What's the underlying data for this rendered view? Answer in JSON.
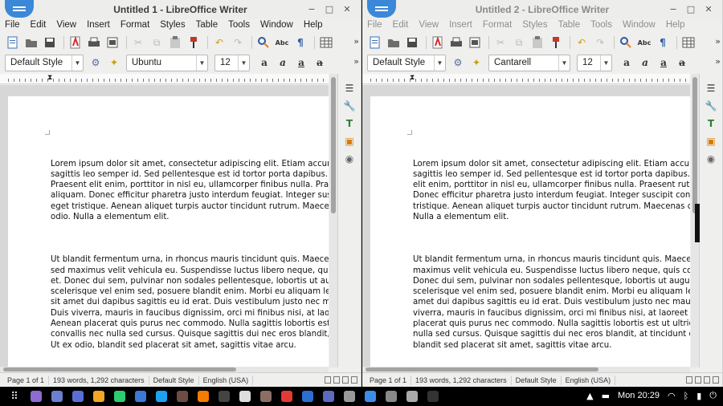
{
  "windows": [
    {
      "title": "Untitled 1 - LibreOffice Writer",
      "menu": [
        "File",
        "Edit",
        "View",
        "Insert",
        "Format",
        "Styles",
        "Table",
        "Tools",
        "Window",
        "Help"
      ],
      "paragraph_style": "Default Style",
      "font_name": "Ubuntu",
      "font_size": "12",
      "paragraphs": [
        "Lorem ipsum dolor sit amet, consectetur adipiscing elit. Etiam accumsan\nsagittis leo semper id. Sed pellentesque est id tortor porta dapibus. In ut\nPraesent elit enim, porttitor in nisl eu, ullamcorper finibus nulla. Praesen\naliquam. Donec efficitur pharetra justo interdum feugiat. Integer suscipit\neget tristique. Aenean aliquet turpis auctor tincidunt rutrum. Maecenas c\nodio. Nulla a elementum elit.",
        "Ut blandit fermentum urna, in rhoncus mauris tincidunt quis. Maecenas s\nsed maximus velit vehicula eu. Suspendisse luctus libero neque, quis cons\net. Donec dui sem, pulvinar non sodales pellentesque, lobortis ut augue.\nscelerisque vel enim sed, posuere blandit enim. Morbi eu aliquam leo. Qu\nsit amet dui dapibus sagittis eu id erat. Duis vestibulum justo nec mauris\nDuis viverra, mauris in faucibus dignissim, orci mi finibus nisi, at laoreet le\nAenean placerat quis purus nec commodo. Nulla sagittis lobortis est ut ul\nconvallis nec nulla sed cursus. Quisque sagittis dui nec eros blandit, at tin\nUt ex odio, blandit sed placerat sit amet, sagittis vitae arcu."
      ],
      "status": {
        "page": "Page 1 of 1",
        "words": "193 words, 1,292 characters",
        "style": "Default Style",
        "language": "English (USA)"
      }
    },
    {
      "title": "Untitled 2 - LibreOffice Writer",
      "menu": [
        "File",
        "Edit",
        "View",
        "Insert",
        "Format",
        "Styles",
        "Table",
        "Tools",
        "Window",
        "Help"
      ],
      "paragraph_style": "Default Style",
      "font_name": "Cantarell",
      "font_size": "12",
      "paragraphs": [
        "Lorem ipsum dolor sit amet, consectetur adipiscing elit. Etiam accumsan nib\nsagittis leo semper id. Sed pellentesque est id tortor porta dapibus. In ut or\nelit enim, porttitor in nisl eu, ullamcorper finibus nulla. Praesent rutrum inte\nDonec efficitur pharetra justo interdum feugiat. Integer suscipit consequat s\ntristique. Aenean aliquet turpis auctor tincidunt rutrum. Maecenas convallis\nNulla a elementum elit.",
        "Ut blandit fermentum urna, in rhoncus mauris tincidunt quis. Maecenas susc\nmaximus velit vehicula eu. Suspendisse luctus libero neque, quis consequat\nDonec dui sem, pulvinar non sodales pellentesque, lobortis ut augue. Nunc\nscelerisque vel enim sed, posuere blandit enim. Morbi eu aliquam leo. Quisq\namet dui dapibus sagittis eu id erat. Duis vestibulum justo nec mauris faucib\nviverra, mauris in faucibus dignissim, orci mi finibus nisi, at laoreet lectus nu\nplacerat quis purus nec commodo. Nulla sagittis lobortis est ut ultricies. Qui\nnulla sed cursus. Quisque sagittis dui nec eros blandit, at tincidunt odio orna\nblandit sed placerat sit amet, sagittis vitae arcu."
      ],
      "status": {
        "page": "Page 1 of 1",
        "words": "193 words, 1,292 characters",
        "style": "Default Style",
        "language": "English (USA)"
      }
    }
  ],
  "window_controls": {
    "minimize": "−",
    "maximize": "□",
    "close": "✕"
  },
  "more_glyph": "»",
  "taskbar": {
    "apps": [
      "#8e6bd1",
      "#6b7fd1",
      "#5a6fd6",
      "#f5a623",
      "#2ecc71",
      "#3a7ad6",
      "#1da1f2",
      "#6d4c41",
      "#f57c00",
      "#444444",
      "#dddddd",
      "#8d6e63",
      "#e53935",
      "#2c6fd1",
      "#5c6bc0",
      "#999999",
      "#3b8ee8",
      "#888888",
      "#aaaaaa",
      "#333333"
    ],
    "clock": "Mon 20:29"
  },
  "colors": {
    "accent": "#3b88d8",
    "window_bg": "#efefee",
    "doc_bg": "#d7d7d7"
  }
}
